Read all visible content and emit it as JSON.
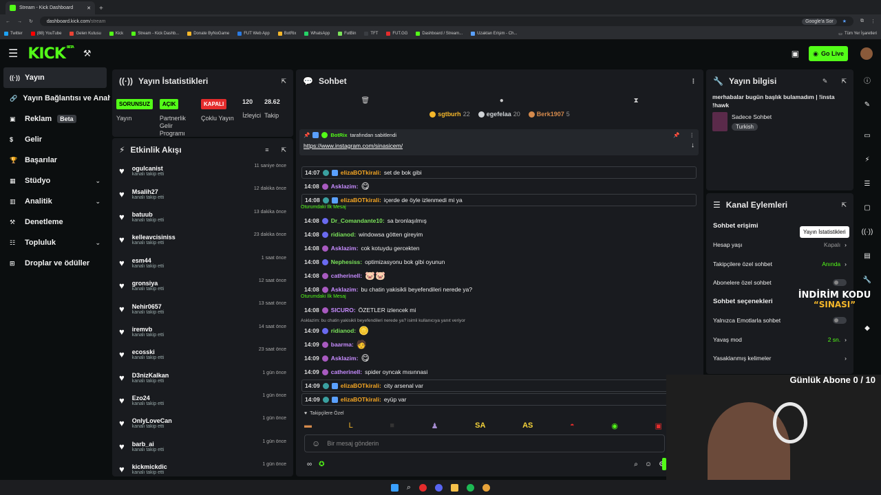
{
  "browser": {
    "tab_title": "Stream - Kick Dashboard",
    "url_host": "dashboard.kick.com",
    "url_path": "/stream",
    "google_btn": "Google'a Sor",
    "bookmarks": [
      "Twitter",
      "(88) YouTube",
      "Gelen Kutusu",
      "Kick",
      "Stream - Kick Dashb...",
      "Donate ByNoGame",
      "FUT Web App",
      "BotRix",
      "WhatsApp",
      "FutBin",
      "TFT",
      "FUT.GG",
      "Dashboard / Stream...",
      "Uzaktan Erişim - Ch..."
    ],
    "all_bookmarks": "Tüm Yer İşaretleri"
  },
  "header": {
    "logo": "KICK",
    "logo_sup": "BETA",
    "go_live": "Go Live"
  },
  "sidebar": [
    {
      "label": "Yayın",
      "icon": "broadcast-icon",
      "active": true
    },
    {
      "label": "Yayın Bağlantısı ve Anahtarı",
      "icon": "link-icon"
    },
    {
      "label": "Reklam",
      "icon": "ad-icon",
      "badge": "Beta"
    },
    {
      "label": "Gelir",
      "icon": "money-icon"
    },
    {
      "label": "Başarılar",
      "icon": "trophy-icon"
    },
    {
      "label": "Stüdyo",
      "icon": "studio-icon",
      "chev": true
    },
    {
      "label": "Analitik",
      "icon": "chart-icon",
      "chev": true
    },
    {
      "label": "Denetleme",
      "icon": "hammer-icon"
    },
    {
      "label": "Topluluk",
      "icon": "community-icon",
      "chev": true
    },
    {
      "label": "Droplar ve ödüller",
      "icon": "gift-icon"
    }
  ],
  "stats": {
    "title": "Yayın İstatistikleri",
    "items": [
      {
        "badge": "SORUNSUZ",
        "color": "#53fc18",
        "label": "Yayın"
      },
      {
        "badge": "AÇIK",
        "color": "#53fc18",
        "label": "Partnerlik Gelir Programı"
      },
      {
        "badge": "KAPALI",
        "color": "#e52c2c",
        "label": "Çoklu Yayın"
      },
      {
        "value": "120",
        "label": "İzleyici"
      },
      {
        "value": "28.62",
        "label": "Takip"
      }
    ]
  },
  "activity": {
    "title": "Etkinlik Akışı",
    "sub": "kanalı takip etti",
    "items": [
      {
        "name": "ogulcanist",
        "time": "11 saniye önce"
      },
      {
        "name": "Msalih27",
        "time": "12 dakika önce"
      },
      {
        "name": "batuub",
        "time": "13 dakika önce"
      },
      {
        "name": "kelleavcisiniss",
        "time": "23 dakika önce"
      },
      {
        "name": "esm44",
        "time": "1 saat önce"
      },
      {
        "name": "gronsiya",
        "time": "12 saat önce"
      },
      {
        "name": "Nehir0657",
        "time": "13 saat önce"
      },
      {
        "name": "iremvb",
        "time": "14 saat önce"
      },
      {
        "name": "ecosski",
        "time": "23 saat önce"
      },
      {
        "name": "D3nizKalkan",
        "time": "1 gün önce"
      },
      {
        "name": "Ezo24",
        "time": "1 gün önce"
      },
      {
        "name": "OnlyLoveCan",
        "time": "1 gün önce"
      },
      {
        "name": "barb_ai",
        "time": "1 gün önce"
      },
      {
        "name": "kickmickdic",
        "time": "1 gün önce"
      }
    ]
  },
  "chat": {
    "title": "Sohbet",
    "leaders": [
      {
        "name": "sgtburh",
        "count": "22",
        "color": "#f5b72a"
      },
      {
        "name": "egefelaa",
        "count": "20",
        "color": "#cfd3d6"
      },
      {
        "name": "Berk1907",
        "count": "5",
        "color": "#d58a4c"
      }
    ],
    "pinned_by": "BotRix",
    "pinned_suffix": "tarafından sabitlendi",
    "pinned_link": "https://www.instagram.com/sinasicem/",
    "first_label": "Oturumdaki İlk Mesaj",
    "reply_note": "Asklazim: bu chatin yakisikli beyefendileri nerede ya? isimli kullanıcıya yanıt veriyor",
    "messages": [
      {
        "time": "14:07",
        "user": "elizaBOTkirali",
        "color": "#f5a623",
        "text": "set de bok gibi",
        "hl": true,
        "bot": true
      },
      {
        "time": "14:08",
        "user": "Asklazim",
        "color": "#c78cff",
        "text": "",
        "emote": "😋"
      },
      {
        "time": "14:08",
        "user": "elizaBOTkirali",
        "color": "#f5a623",
        "text": "içerde de öyle izlenmedi mi ya",
        "hl": true,
        "bot": true
      },
      {
        "time": "14:08",
        "user": "Dr_Comandante10",
        "color": "#7be35a",
        "text": "sa bronlaşılmış",
        "first": true
      },
      {
        "time": "14:08",
        "user": "ridianod",
        "color": "#7be35a",
        "text": "windowsa götten gireyim"
      },
      {
        "time": "14:08",
        "user": "Asklazim",
        "color": "#c78cff",
        "text": "cok kotuydu gercekten"
      },
      {
        "time": "14:08",
        "user": "Nephesiss",
        "color": "#7be35a",
        "text": "optimizasyonu bok gibi oyunun"
      },
      {
        "time": "14:08",
        "user": "catherinell",
        "color": "#c78cff",
        "text": "",
        "emote": "🐷🐷"
      },
      {
        "time": "14:08",
        "user": "Asklazim",
        "color": "#c78cff",
        "text": "bu chatin yakisikli beyefendileri nerede ya?"
      },
      {
        "time": "14:08",
        "user": "SICURO",
        "color": "#c78cff",
        "text": "ÖZETLER izlencek mi",
        "first": true
      },
      {
        "time": "14:09",
        "user": "ridianod",
        "color": "#7be35a",
        "text": "",
        "emote": "🪙"
      },
      {
        "time": "14:09",
        "user": "baarma",
        "color": "#c78cff",
        "text": "",
        "emote": "🧑"
      },
      {
        "time": "14:09",
        "user": "Asklazim",
        "color": "#c78cff",
        "text": "",
        "emote": "😋"
      },
      {
        "time": "14:09",
        "user": "catherinell",
        "color": "#c78cff",
        "text": "spider oyncak mısınnasi"
      },
      {
        "time": "14:09",
        "user": "elizaBOTkirali",
        "color": "#f5a623",
        "text": "city arsenal var",
        "hl": true,
        "bot": true
      },
      {
        "time": "14:09",
        "user": "elizaBOTkirali",
        "color": "#f5a623",
        "text": "eyüp var",
        "hl": true,
        "bot": true
      }
    ],
    "followers_only": "Takipçilere Özel",
    "placeholder": "Bir mesaj gönderin"
  },
  "info": {
    "title": "Yayın bilgisi",
    "stream_title": "merhabalar bugün başlık bulamadım | !insta !hawk",
    "category": "Sadece Sohbet",
    "tag": "Turkish"
  },
  "channel": {
    "title": "Kanal Eylemleri",
    "access_head": "Sohbet erişimi",
    "tooltip": "Yayın İstatistikleri",
    "account_age": "Hesap yaşı",
    "account_age_val": "Kapalı",
    "followers_chat": "Takipçilere özel sohbet",
    "followers_chat_val": "Anında",
    "subs_chat": "Abonelere özel sohbet",
    "options_head": "Sohbet seçenekleri",
    "emote_only": "Yalnızca Emotlarla sohbet",
    "slow_mode": "Yavaş mod",
    "slow_mode_val": "2 sn.",
    "banned_words": "Yasaklanmış kelimeler"
  },
  "overlay": {
    "discount_line1": "İNDİRİM KODU",
    "discount_line2": "“SINASI”",
    "subs_goal": "Günlük Abone 0 / 10"
  }
}
